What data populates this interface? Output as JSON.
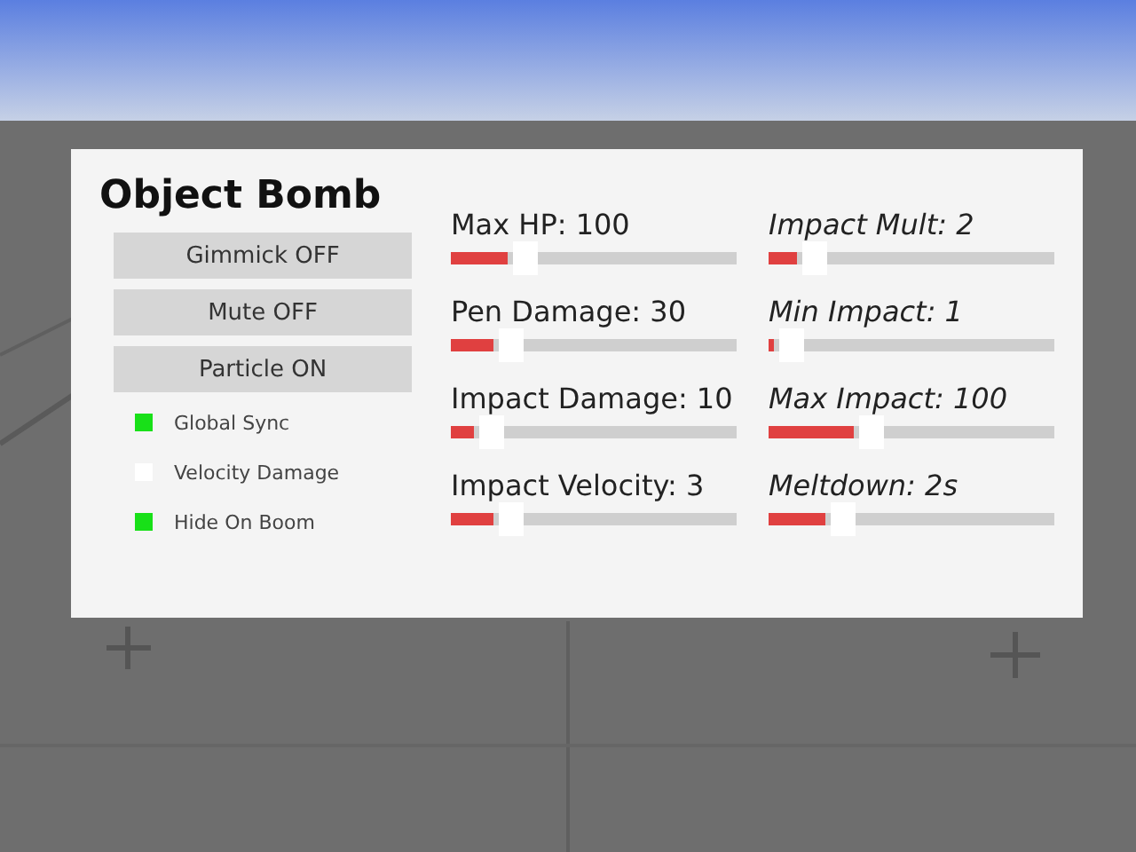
{
  "panel": {
    "title": "Object Bomb",
    "buttons": [
      {
        "label": "Gimmick OFF"
      },
      {
        "label": "Mute OFF"
      },
      {
        "label": "Particle ON"
      }
    ],
    "toggles": [
      {
        "label": "Global Sync",
        "checked": true
      },
      {
        "label": "Velocity Damage",
        "checked": false
      },
      {
        "label": "Hide On Boom",
        "checked": true
      }
    ],
    "sliders": [
      {
        "label": "Max HP: 100",
        "level": 0.2
      },
      {
        "label": "Impact Mult: 2",
        "level": 0.1
      },
      {
        "label": "Pen Damage: 30",
        "level": 0.15
      },
      {
        "label": "Min Impact: 1",
        "level": 0.02
      },
      {
        "label": "Impact Damage: 10",
        "level": 0.08
      },
      {
        "label": "Max Impact: 100",
        "level": 0.3
      },
      {
        "label": "Impact Velocity: 3",
        "level": 0.15
      },
      {
        "label": "Meltdown: 2s",
        "level": 0.2
      }
    ]
  }
}
